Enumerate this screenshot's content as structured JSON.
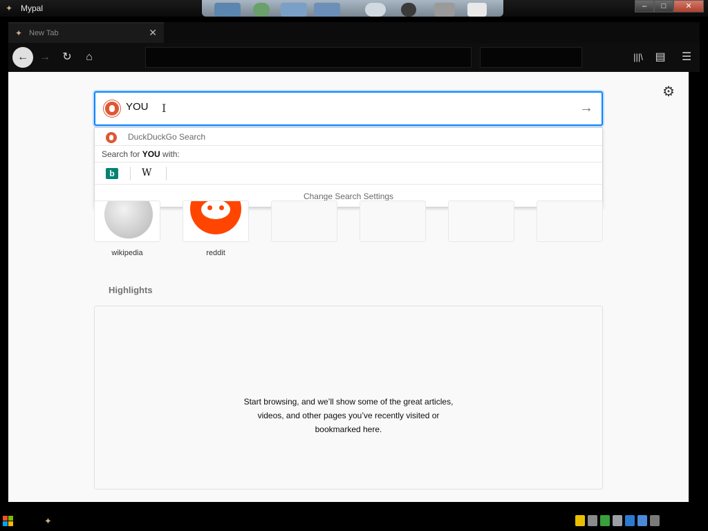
{
  "window": {
    "app_icon": "mypal-icon",
    "title": "Mypal",
    "minimize_label": "–",
    "maximize_label": "□",
    "close_label": "✕"
  },
  "tab": {
    "title": "New Tab",
    "close_label": "✕"
  },
  "toolbar": {
    "back_label": "←",
    "forward_label": "→",
    "reload_label": "↻",
    "home_label": "⌂",
    "library_label": "|||\\",
    "sidebar_label": "▤",
    "menu_label": "☰"
  },
  "search": {
    "value": "YOU",
    "go_label": "→",
    "engine_icon": "duckduckgo-icon",
    "cursor_label": "I"
  },
  "suggestions": {
    "engine_label": "DuckDuckGo Search",
    "search_for_prefix": "Search for ",
    "search_for_term": "YOU",
    "search_for_suffix": " with:",
    "engines": [
      {
        "name": "bing-icon",
        "glyph": "b"
      },
      {
        "name": "wikipedia-icon",
        "glyph": "W"
      }
    ],
    "change_settings_label": "Change Search Settings"
  },
  "top_sites": [
    {
      "label": "wikipedia"
    },
    {
      "label": "reddit"
    },
    {
      "label": ""
    },
    {
      "label": ""
    },
    {
      "label": ""
    },
    {
      "label": ""
    }
  ],
  "highlights": {
    "title": "Highlights",
    "empty_line1": "Start browsing, and we’ll show some of the great articles,",
    "empty_line2": "videos, and other pages you’ve recently visited or",
    "empty_line3": "bookmarked here."
  },
  "settings_icon": "gear-icon",
  "colors": {
    "accent": "#0a84ff",
    "duckduckgo": "#de5833",
    "reddit": "#ff4500",
    "bing": "#008373"
  }
}
